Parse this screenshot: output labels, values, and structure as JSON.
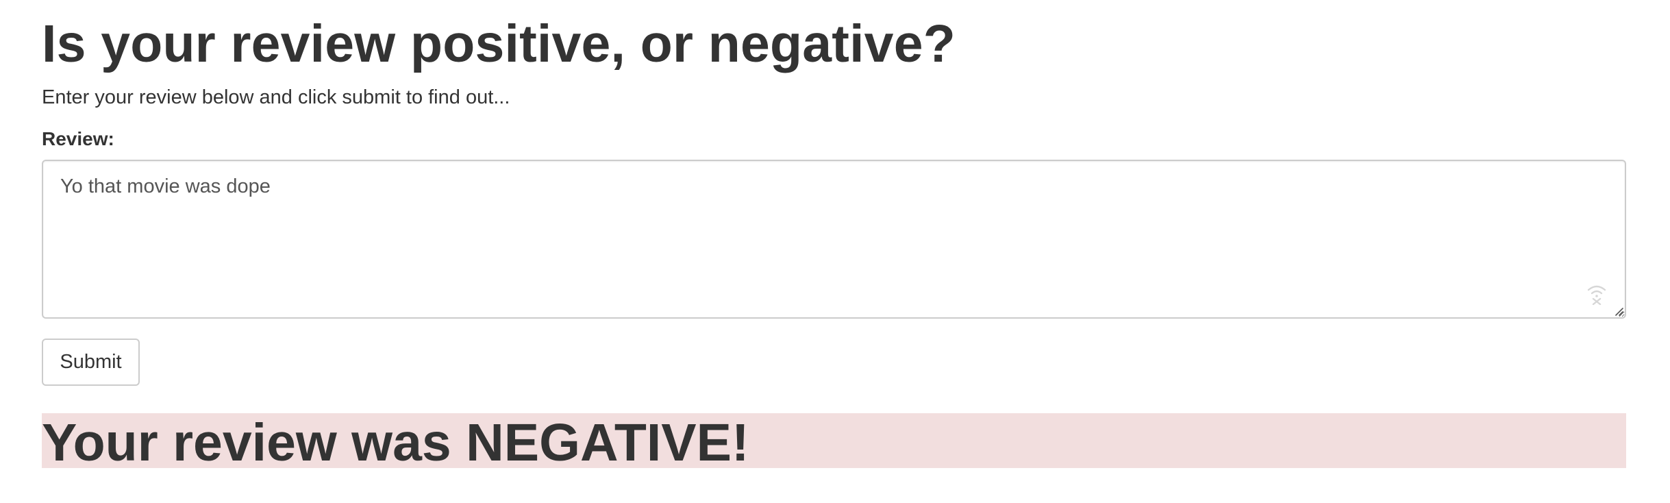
{
  "header": {
    "title": "Is your review positive, or negative?",
    "intro": "Enter your review below and click submit to find out..."
  },
  "form": {
    "review_label": "Review:",
    "review_value": "Yo that movie was dope",
    "submit_label": "Submit"
  },
  "result": {
    "text": "Your review was NEGATIVE!",
    "background_color": "#f2dede",
    "sentiment": "negative"
  },
  "icons": {
    "textarea_widget": "grammar-check-icon",
    "textarea_resize": "resize-handle-icon"
  }
}
